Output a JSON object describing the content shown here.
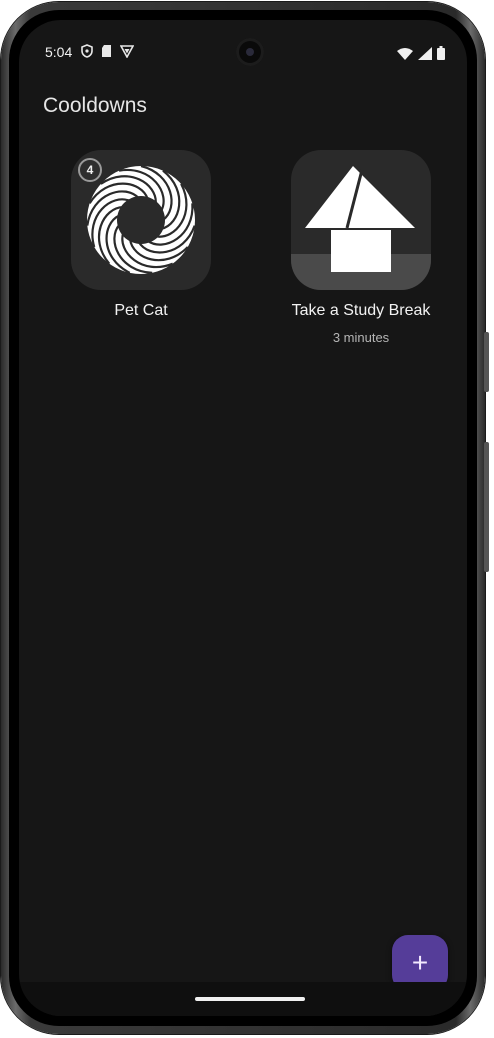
{
  "status_bar": {
    "time": "5:04",
    "left_icons": [
      "shield-icon",
      "sd-card-icon",
      "vpn-icon"
    ],
    "right_icons": [
      "wifi-icon",
      "signal-icon",
      "battery-icon"
    ]
  },
  "app": {
    "title": "Cooldowns"
  },
  "items": [
    {
      "title": "Pet Cat",
      "subtitle": "",
      "badge": "4",
      "icon": "spiral-icon"
    },
    {
      "title": "Take a Study Break",
      "subtitle": "3 minutes",
      "badge": "",
      "icon": "house-icon"
    }
  ],
  "fab": {
    "label": "+"
  },
  "colors": {
    "screen_background": "#161616",
    "tile_background": "#2a2a2a",
    "fab_background": "#553d99"
  }
}
